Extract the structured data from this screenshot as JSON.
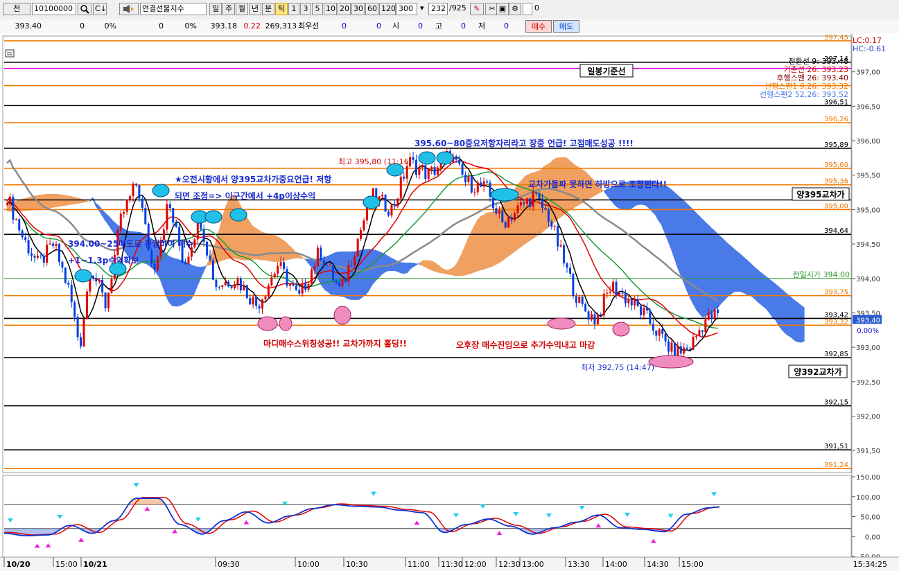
{
  "toolbar": {
    "prefix_label": "전",
    "code_value": "10100000",
    "search_icon": "magnifier-icon",
    "search2_icon": "c-arrow-icon",
    "speaker_icon": "speaker-icon",
    "instrument_name": "연결선물지수",
    "periods": [
      "일",
      "주",
      "월",
      "년",
      "분",
      "틱"
    ],
    "active_period": "틱",
    "intervals": [
      "1",
      "3",
      "5",
      "10",
      "20",
      "30",
      "60",
      "120"
    ],
    "interval_value": "300",
    "count_value": "232",
    "count_total": "/925",
    "end_icons": [
      "draw-tools-icon",
      "scissors-icon",
      "save-icon",
      "settings-gear-icon"
    ],
    "checkbox_label": "0"
  },
  "quote": {
    "price": "393.40",
    "vol1": "0",
    "pct1": "0%",
    "vol2": "0",
    "pct2": "0%",
    "ref": "393.18",
    "chg": "0.22",
    "volume": "269,313",
    "best_label": "최우선",
    "best1": "0",
    "best2": "0",
    "open_label": "시",
    "open_val": "0",
    "high_label": "고",
    "high_val": "0",
    "low_label": "저",
    "low_val": "0",
    "buy_label": "매수",
    "sell_label": "매도"
  },
  "colors": {
    "candle_up": "#e00000",
    "candle_down": "#0040e0",
    "orange_line": "#f07800",
    "magenta_line": "#e000e0",
    "cloud_orange": "#f0a060",
    "cloud_blue": "#4a7ae8",
    "annotation_blue": "#1a2ad0",
    "annotation_red": "#d00000",
    "cyan_marker": "#20c0e8",
    "pink_marker": "#f08cc0"
  },
  "chart_data": {
    "type": "candlestick",
    "y_range": [
      391.2,
      397.5
    ],
    "price_axis_ticks": [
      "397,00",
      "396,50",
      "396,00",
      "395,50",
      "395,00",
      "394,50",
      "394,00",
      "393,50",
      "393,00",
      "392,50",
      "392,00",
      "391,50"
    ],
    "price_axis_tick_values": [
      397.0,
      396.5,
      396.0,
      395.5,
      395.0,
      394.5,
      394.0,
      393.5,
      393.0,
      392.5,
      392.0,
      391.5
    ],
    "time_labels": [
      "10/20",
      "15:00",
      "10/21",
      "09:30",
      "10:00",
      "10:30",
      "11:00",
      "11:30",
      "12:00",
      "12:30",
      "13:00",
      "13:30",
      "14:00",
      "14:30",
      "15:00"
    ],
    "current_time": "15:34:25",
    "hlines": [
      {
        "value": 397.45,
        "color": "orange",
        "label": "397,45",
        "label_color": "orange"
      },
      {
        "value": 397.14,
        "color": "black",
        "label": "397,14",
        "label_color": "black"
      },
      {
        "value": 397.05,
        "color": "magenta",
        "label": "",
        "label_color": "magenta"
      },
      {
        "value": 396.8,
        "color": "orange",
        "label": "",
        "label_color": "orange"
      },
      {
        "value": 396.51,
        "color": "black",
        "label": "396,51",
        "label_color": "black"
      },
      {
        "value": 396.26,
        "color": "orange",
        "label": "396,26",
        "label_color": "orange"
      },
      {
        "value": 395.89,
        "color": "black",
        "label": "395,89",
        "label_color": "black"
      },
      {
        "value": 395.6,
        "color": "orange",
        "label": "395,60",
        "label_color": "orange"
      },
      {
        "value": 395.36,
        "color": "orange",
        "label": "395,36",
        "label_color": "orange"
      },
      {
        "value": 395.14,
        "color": "black",
        "label": "",
        "label_color": "black"
      },
      {
        "value": 395.0,
        "color": "orange",
        "label": "395,00",
        "label_color": "orange"
      },
      {
        "value": 394.64,
        "color": "black",
        "label": "394,64",
        "label_color": "black"
      },
      {
        "value": 394.0,
        "color": "green",
        "label": "",
        "label_color": "green"
      },
      {
        "value": 393.75,
        "color": "orange",
        "label": "393,75",
        "label_color": "orange"
      },
      {
        "value": 393.42,
        "color": "black",
        "label": "393,42",
        "label_color": "black"
      },
      {
        "value": 393.32,
        "color": "orange",
        "label": "393,32",
        "label_color": "orange"
      },
      {
        "value": 392.85,
        "color": "black",
        "label": "392,85",
        "label_color": "black"
      },
      {
        "value": 392.15,
        "color": "black",
        "label": "392,15",
        "label_color": "black"
      },
      {
        "value": 391.51,
        "color": "black",
        "label": "391,51",
        "label_color": "black"
      },
      {
        "value": 391.24,
        "color": "orange",
        "label": "391,24",
        "label_color": "orange"
      }
    ],
    "legend": {
      "lc": "LC:0.17",
      "hc": "HC:-0.61",
      "items": [
        {
          "text": "전환선 9: 393.48",
          "color": "#000000"
        },
        {
          "text": "기준선 26: 393.23",
          "color": "#d00000"
        },
        {
          "text": "후행스팬 26: 393.40",
          "color": "#8b0000"
        },
        {
          "text": "선행스팬1 9,26: 393.32",
          "color": "#f07800"
        },
        {
          "text": "선행스팬2 52,26: 393.52",
          "color": "#4a7ae8"
        }
      ]
    },
    "line_labels": [
      {
        "text": "일봉기준선",
        "value": 397.05
      },
      {
        "text": "양395교차가",
        "value": 395.25
      },
      {
        "text": "양392교차가",
        "value": 392.65
      }
    ],
    "prev_open_label": "전일시가 394.00",
    "current_price_label": "393,40",
    "zero_pct_label": "0,00%",
    "annotations": [
      {
        "text": "395.60~80중요저항자리라고 장중 언급! 고점매도성공 !!!!",
        "color": "blue"
      },
      {
        "text": "★오전시황에서 양395교차가중요언급! 저항",
        "color": "blue"
      },
      {
        "text": "되면 조정=> 이구간에서 +4p이상수익",
        "color": "blue"
      },
      {
        "text": "교차가돌파 못하면 하방으로 조정된다!!",
        "color": "blue"
      },
      {
        "text": "394.00~25매도로 진입하여 매수",
        "color": "blue"
      },
      {
        "text": "+1~1.3p수익확보",
        "color": "blue"
      },
      {
        "text": "마디매수스위칭성공!! 교차가까지 홀딩!!",
        "color": "red"
      },
      {
        "text": "오후장 매수진입으로 추가수익내고 마감",
        "color": "red"
      },
      {
        "text": "최고 395,80 (11:16)",
        "color": "red"
      },
      {
        "text": "최저 392,75 (14:47)",
        "color": "blue"
      }
    ],
    "oscillator": {
      "y_range": [
        -50,
        150
      ],
      "ticks": [
        "150,00",
        "100,00",
        "50,00",
        "0,00",
        "-50,00"
      ],
      "tick_values": [
        150,
        100,
        50,
        0,
        -50
      ],
      "key_points": [
        [
          0,
          8
        ],
        [
          4,
          2
        ],
        [
          8,
          4
        ],
        [
          12,
          28
        ],
        [
          16,
          8
        ],
        [
          20,
          40
        ],
        [
          24,
          96
        ],
        [
          28,
          96
        ],
        [
          32,
          30
        ],
        [
          36,
          6
        ],
        [
          40,
          40
        ],
        [
          44,
          62
        ],
        [
          48,
          34
        ],
        [
          52,
          52
        ],
        [
          56,
          70
        ],
        [
          60,
          80
        ],
        [
          64,
          76
        ],
        [
          68,
          74
        ],
        [
          72,
          66
        ],
        [
          76,
          60
        ],
        [
          80,
          10
        ],
        [
          84,
          30
        ],
        [
          88,
          44
        ],
        [
          92,
          26
        ],
        [
          96,
          6
        ],
        [
          100,
          22
        ],
        [
          104,
          36
        ],
        [
          108,
          54
        ],
        [
          112,
          22
        ],
        [
          116,
          18
        ],
        [
          120,
          12
        ],
        [
          124,
          56
        ],
        [
          128,
          72
        ],
        [
          130,
          74
        ]
      ]
    }
  }
}
